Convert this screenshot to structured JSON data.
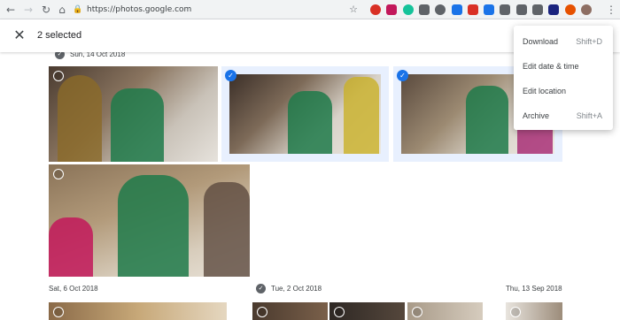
{
  "browser": {
    "url": "https://photos.google.com",
    "extensions": [
      {
        "icon": "opera-icon",
        "color": "#d93025",
        "round": true
      },
      {
        "icon": "feedly-icon",
        "color": "#c2185b",
        "round": false
      },
      {
        "icon": "grammarly-icon",
        "color": "#15c39a",
        "round": true
      },
      {
        "icon": "pocket-icon",
        "color": "#5f6368",
        "round": false
      },
      {
        "icon": "speed-icon",
        "color": "#5f6368",
        "round": true
      },
      {
        "icon": "clip-icon",
        "color": "#1a73e8",
        "round": false
      },
      {
        "icon": "red-square-icon",
        "color": "#d93025",
        "round": false
      },
      {
        "icon": "bing-icon",
        "color": "#1a73e8",
        "round": false
      },
      {
        "icon": "shield-icon",
        "color": "#5f6368",
        "round": false
      },
      {
        "icon": "kahoot-icon",
        "color": "#5f6368",
        "round": false
      },
      {
        "icon": "photo-icon",
        "color": "#5f6368",
        "round": false
      },
      {
        "icon": "todo-icon",
        "color": "#1a237e",
        "round": false
      },
      {
        "icon": "flame-icon",
        "color": "#e65100",
        "round": true
      },
      {
        "icon": "profile-avatar",
        "color": "#8d6e63",
        "round": true
      }
    ]
  },
  "appbar": {
    "selected_label": "2 selected"
  },
  "dates": {
    "d1": "Sun, 14 Oct 2018",
    "d2": "Sat, 6 Oct 2018",
    "d3": "Tue, 2 Oct 2018",
    "d4": "Thu, 13 Sep 2018"
  },
  "menu": {
    "items": [
      {
        "label": "Download",
        "shortcut": "Shift+D"
      },
      {
        "label": "Edit date & time",
        "shortcut": ""
      },
      {
        "label": "Edit location",
        "shortcut": ""
      },
      {
        "label": "Archive",
        "shortcut": "Shift+A"
      }
    ]
  },
  "colors": {
    "accent": "#1a73e8",
    "selected_bg": "#e8f0fe"
  }
}
